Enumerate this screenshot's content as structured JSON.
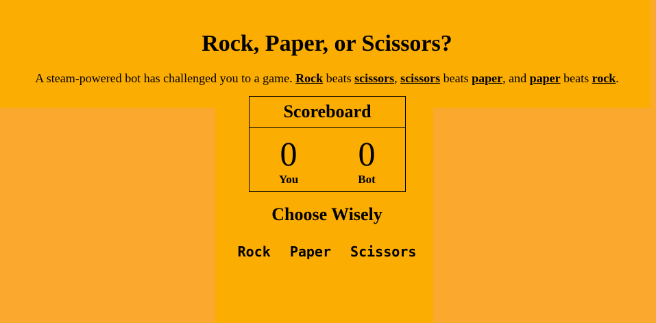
{
  "header": {
    "title": "Rock, Paper, or Scissors?",
    "intro": {
      "prefix": "A steam-powered bot has challenged you to a game.",
      "rock": "Rock",
      "beats1": "beats",
      "scissors1": "scissors",
      "comma": ",",
      "scissors2": "scissors",
      "beats2": "beats",
      "paper1": "paper",
      "and": ", and",
      "paper2": "paper",
      "beats3": "beats",
      "rock2": "rock",
      "period": "."
    }
  },
  "scoreboard": {
    "title": "Scoreboard",
    "you": {
      "score": "0",
      "label": "You"
    },
    "bot": {
      "score": "0",
      "label": "Bot"
    }
  },
  "choose": {
    "heading": "Choose Wisely",
    "options": [
      "Rock",
      "Paper",
      "Scissors"
    ]
  },
  "colors": {
    "panel": "#FBAD01",
    "side": "#FAA82E",
    "text": "#000000"
  }
}
